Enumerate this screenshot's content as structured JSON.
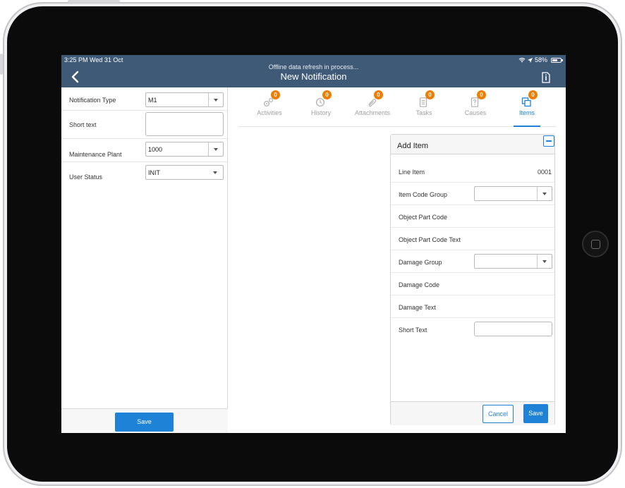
{
  "status_bar": {
    "time": "3:25 PM   Wed 31 Oct",
    "battery": "58%"
  },
  "header": {
    "subtitle": "Offline data refresh in process...",
    "title": "New Notification"
  },
  "left_form": {
    "notification_type": {
      "label": "Notification Type",
      "value": "M1"
    },
    "short_text": {
      "label": "Short text",
      "value": ""
    },
    "maintenance_plant": {
      "label": "Maintenance Plant",
      "value": "1000"
    },
    "user_status": {
      "label": "User Status",
      "value": "INIT"
    },
    "save_label": "Save"
  },
  "tabs": [
    {
      "label": "Activities",
      "badge": "0",
      "icon": "gears-icon"
    },
    {
      "label": "History",
      "badge": "0",
      "icon": "clock-icon"
    },
    {
      "label": "Attachments",
      "badge": "0",
      "icon": "paperclip-icon"
    },
    {
      "label": "Tasks",
      "badge": "0",
      "icon": "checklist-icon"
    },
    {
      "label": "Causes",
      "badge": "0",
      "icon": "question-doc-icon"
    },
    {
      "label": "Items",
      "badge": "0",
      "icon": "copy-icon"
    }
  ],
  "add_item": {
    "title": "Add Item",
    "line_item": {
      "label": "Line Item",
      "value": "0001"
    },
    "item_code_group": {
      "label": "Item Code Group",
      "value": ""
    },
    "object_part_code": {
      "label": "Object Part Code"
    },
    "object_part_code_text": {
      "label": "Object Part Code Text"
    },
    "damage_group": {
      "label": "Damage Group",
      "value": ""
    },
    "damage_code": {
      "label": "Damage Code"
    },
    "damage_text": {
      "label": "Damage Text"
    },
    "short_text": {
      "label": "Short Text",
      "value": ""
    },
    "cancel_label": "Cancel",
    "save_label": "Save"
  },
  "colors": {
    "header": "#3f5a77",
    "accent": "#1e83d6",
    "badge": "#ef7d00"
  }
}
